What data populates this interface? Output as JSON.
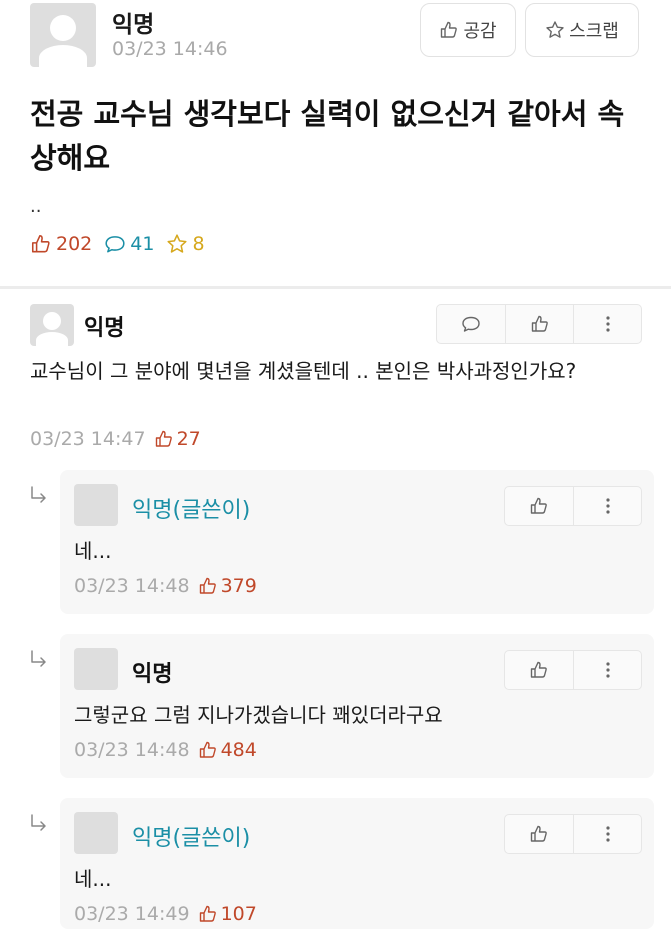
{
  "article": {
    "author": "익명",
    "date": "03/23 14:46",
    "like_button": "공감",
    "scrap_button": "스크랩",
    "title": "전공 교수님 생각보다 실력이 없으신거 같아서 속상해요",
    "body": "..",
    "stats": {
      "likes": "202",
      "comments": "41",
      "scraps": "8"
    }
  },
  "comments": [
    {
      "author": "익명",
      "text": "교수님이 그 분야에 몇년을 계셨을텐데 .. 본인은 박사과정인가요?",
      "date": "03/23 14:47",
      "likes": "27",
      "replies": [
        {
          "author": "익명(글쓴이)",
          "text": "네...",
          "date": "03/23 14:48",
          "likes": "379"
        },
        {
          "author": "익명",
          "text": "그렇군요 그럼 지나가겠습니다 꽤있더라구요",
          "date": "03/23 14:48",
          "likes": "484"
        },
        {
          "author": "익명(글쓴이)",
          "text": "네...",
          "date": "03/23 14:49",
          "likes": "107"
        }
      ]
    }
  ],
  "icons": {
    "thumbs_up": "thumbs-up-icon",
    "comment": "speech-bubble-icon",
    "star": "star-icon",
    "more": "more-vertical-icon",
    "reply": "reply-arrow-icon"
  },
  "colors": {
    "like": "#c0482a",
    "comment": "#1b8fa6",
    "scrap": "#d6a81d",
    "op_author": "#1b8fa6",
    "meta": "#aaaaaa"
  }
}
